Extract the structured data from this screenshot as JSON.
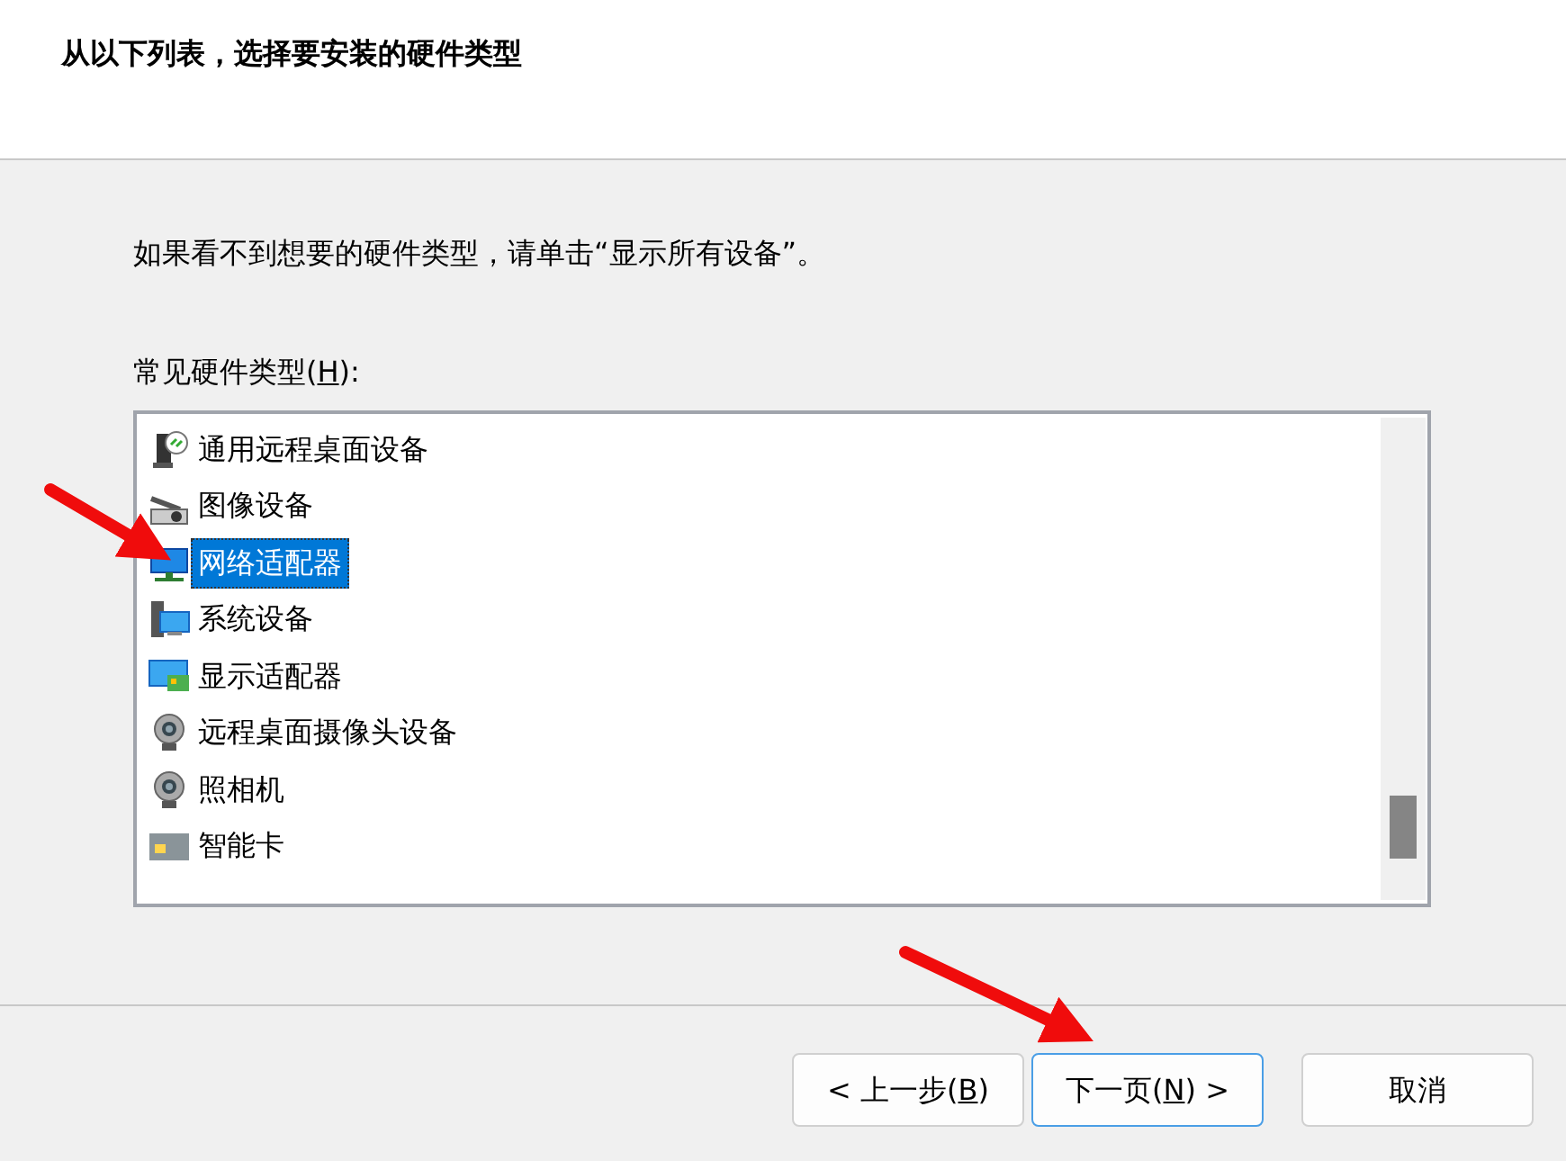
{
  "header": {
    "title": "从以下列表，选择要安装的硬件类型"
  },
  "instruction": "如果看不到想要的硬件类型，请单击“显示所有设备”。",
  "list_label": {
    "before": "常见硬件类型(",
    "key": "H",
    "after": "):"
  },
  "hardware_types": [
    {
      "label": "通用远程桌面设备",
      "kind": "remote",
      "selected": false
    },
    {
      "label": "图像设备",
      "kind": "scanner",
      "selected": false
    },
    {
      "label": "网络适配器",
      "kind": "network",
      "selected": true
    },
    {
      "label": "系统设备",
      "kind": "system",
      "selected": false
    },
    {
      "label": "显示适配器",
      "kind": "display",
      "selected": false
    },
    {
      "label": "远程桌面摄像头设备",
      "kind": "webcam",
      "selected": false
    },
    {
      "label": "照相机",
      "kind": "webcam",
      "selected": false
    },
    {
      "label": "智能卡",
      "kind": "card",
      "selected": false
    }
  ],
  "buttons": [
    {
      "before": "< 上一步(",
      "key": "B",
      "after": ")",
      "default": false
    },
    {
      "before": "下一页(",
      "key": "N",
      "after": ") >",
      "default": true
    },
    {
      "before": "取消",
      "default": false
    }
  ]
}
